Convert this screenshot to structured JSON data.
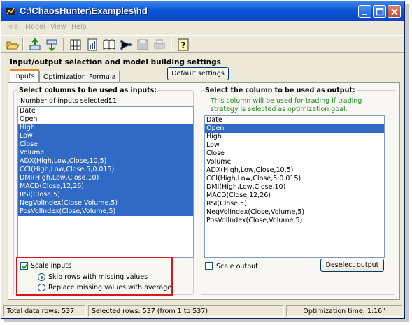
{
  "window": {
    "title": "C:\\ChaosHunter\\Examples\\hd",
    "title_color": "#0a56d8"
  },
  "menu": {
    "items": [
      "File",
      "Model",
      "View",
      "Help"
    ]
  },
  "toolbar": {
    "icons": [
      "open-folder-icon",
      "export-icon",
      "import-icon",
      "grid-icon",
      "report-icon",
      "book-icon",
      "network-icon",
      "save-icon",
      "print-icon",
      "help-icon"
    ]
  },
  "section": {
    "title": "Input/output selection and model building settings"
  },
  "tabs": [
    {
      "label": "Inputs",
      "active": true
    },
    {
      "label": "Optimization",
      "active": false
    },
    {
      "label": "Formula",
      "active": false
    }
  ],
  "default_settings_label": "Default settings",
  "inputs": {
    "title": "Select columns to be used as inputs:",
    "count_label": "Number of inputs selected:",
    "count": "11",
    "items": [
      {
        "label": "Date",
        "selected": false
      },
      {
        "label": "Open",
        "selected": false
      },
      {
        "label": "High",
        "selected": true
      },
      {
        "label": "Low",
        "selected": true
      },
      {
        "label": "Close",
        "selected": true
      },
      {
        "label": "Volume",
        "selected": true
      },
      {
        "label": "ADX(High,Low,Close,10,5)",
        "selected": true
      },
      {
        "label": "CCI(High,Low,Close,5,0.015)",
        "selected": true
      },
      {
        "label": "DMI(High,Low,Close,10)",
        "selected": true
      },
      {
        "label": "MACD(Close,12,26)",
        "selected": true
      },
      {
        "label": "RSI(Close,5)",
        "selected": true
      },
      {
        "label": "NegVolIndex(Close,Volume,5)",
        "selected": true
      },
      {
        "label": "PosVolIndex(Close,Volume,5)",
        "selected": true
      }
    ],
    "scale_inputs_label": "Scale inputs",
    "scale_inputs_checked": true,
    "skip_rows_label": "Skip rows with missing values",
    "replace_missing_label": "Replace missing values with average",
    "missing_value_mode": "skip"
  },
  "output": {
    "title": "Select the column to be used as output:",
    "note": "This column will be used for trading if trading strategy is selected as optimization goal.",
    "note_color": "#1a8a1a",
    "items": [
      {
        "label": "Date",
        "selected": false
      },
      {
        "label": "Open",
        "selected": true
      },
      {
        "label": "High",
        "selected": false
      },
      {
        "label": "Low",
        "selected": false
      },
      {
        "label": "Close",
        "selected": false
      },
      {
        "label": "Volume",
        "selected": false
      },
      {
        "label": "ADX(High,Low,Close,10,5)",
        "selected": false
      },
      {
        "label": "CCI(High,Low,Close,5,0.015)",
        "selected": false
      },
      {
        "label": "DMI(High,Low,Close,10)",
        "selected": false
      },
      {
        "label": "MACD(Close,12,26)",
        "selected": false
      },
      {
        "label": "RSI(Close,5)",
        "selected": false
      },
      {
        "label": "NegVolIndex(Close,Volume,5)",
        "selected": false
      },
      {
        "label": "PosVolIndex(Close,Volume,5)",
        "selected": false
      }
    ],
    "scale_output_label": "Scale output",
    "scale_output_checked": false,
    "deselect_label": "Deselect output"
  },
  "status": {
    "total_rows": "Total data rows: 537",
    "selected_rows": "Selected rows: 537  (from 1 to 537)",
    "optimization_time": "Optimization time: 1:16\""
  },
  "colors": {
    "selection": "#316ac5",
    "annotation_box": "#d81818"
  }
}
